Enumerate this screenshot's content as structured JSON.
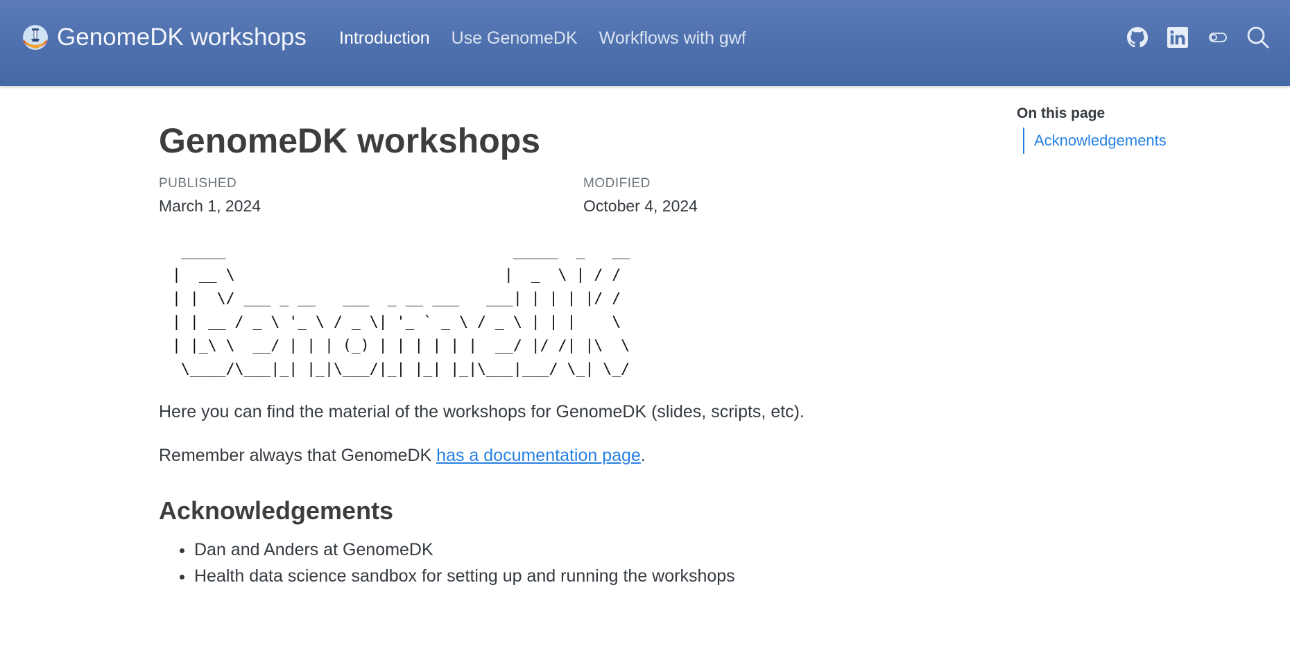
{
  "navbar": {
    "brand_title": "GenomeDK workshops",
    "links": [
      {
        "label": "Introduction",
        "active": true
      },
      {
        "label": "Use GenomeDK",
        "active": false
      },
      {
        "label": "Workflows with gwf",
        "active": false
      }
    ],
    "tools": [
      "github-icon",
      "linkedin-icon",
      "toggle-dark-mode-icon",
      "search-icon"
    ],
    "background_color": "#4a6dab"
  },
  "page": {
    "title": "GenomeDK workshops",
    "published_label": "PUBLISHED",
    "published_date": "March 1, 2024",
    "modified_label": "MODIFIED",
    "modified_date": "October 4, 2024",
    "ascii_art": "  _____                                _____  _   __\n |  __ \\                              |  _  \\ | / /\n | |  \\/ ___ _ __   ___  _ __ ___   ___| | | | |/ /\n | | __ / _ \\ '_ \\ / _ \\| '_ ` _ \\ / _ \\ | | |    \\\n | |_\\ \\  __/ | | | (_) | | | | | |  __/ |/ /| |\\  \\\n  \\____/\\___|_| |_|\\___/|_| |_| |_|\\___|___/ \\_| \\_/",
    "intro_text": "Here you can find the material of the workshops for GenomeDK (slides, scripts, etc).",
    "reminder_prefix": "Remember always that GenomeDK ",
    "reminder_link": "has a documentation page",
    "reminder_suffix": ".",
    "section_heading": "Acknowledgements",
    "acknowledgements": [
      "Dan and Anders at GenomeDK",
      "Health data science sandbox for setting up and running the workshops"
    ]
  },
  "toc": {
    "title": "On this page",
    "items": [
      "Acknowledgements"
    ]
  },
  "colors": {
    "link": "#2780e3",
    "text": "#343a40",
    "heading": "#3d3d3d"
  }
}
